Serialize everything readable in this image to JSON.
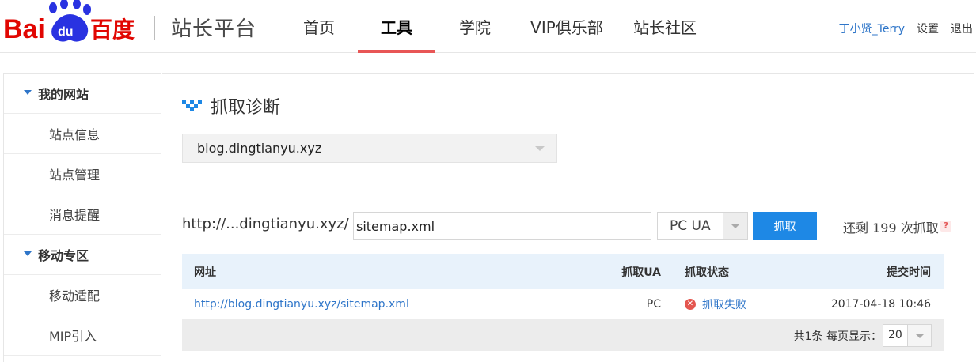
{
  "header": {
    "logo_text": "Baidu百度",
    "site_name": "站长平台",
    "nav": [
      {
        "label": "首页",
        "active": false
      },
      {
        "label": "工具",
        "active": true
      },
      {
        "label": "学院",
        "active": false
      },
      {
        "label": "VIP俱乐部",
        "active": false
      },
      {
        "label": "站长社区",
        "active": false
      }
    ],
    "user": {
      "name": "丁小贤_Terry",
      "settings": "设置",
      "logout": "退出"
    }
  },
  "sidebar": {
    "groups": [
      {
        "label": "我的网站",
        "items": [
          "站点信息",
          "站点管理",
          "消息提醒"
        ]
      },
      {
        "label": "移动专区",
        "items": [
          "移动适配",
          "MIP引入"
        ]
      }
    ]
  },
  "main": {
    "title": "抓取诊断",
    "site_select": "blog.dingtianyu.xyz",
    "url_prefix": "http://...dingtianyu.xyz/",
    "url_value": "sitemap.xml",
    "ua_label": "PC UA",
    "fetch_button": "抓取",
    "remaining": "还剩 199 次抓取",
    "help": "?",
    "table": {
      "headers": {
        "url": "网址",
        "ua": "抓取UA",
        "status": "抓取状态",
        "time": "提交时间"
      },
      "rows": [
        {
          "url": "http://blog.dingtianyu.xyz/sitemap.xml",
          "ua": "PC",
          "status": "抓取失败",
          "time": "2017-04-18 10:46"
        }
      ],
      "footer": {
        "summary": "共1条  每页显示：",
        "page_size": "20"
      }
    }
  },
  "colors": {
    "brand_red": "#e10602",
    "brand_blue": "#2932e1",
    "accent": "#1e88e5",
    "link": "#2f76c9",
    "nav_underline": "#e85656",
    "error": "#e4564f"
  }
}
